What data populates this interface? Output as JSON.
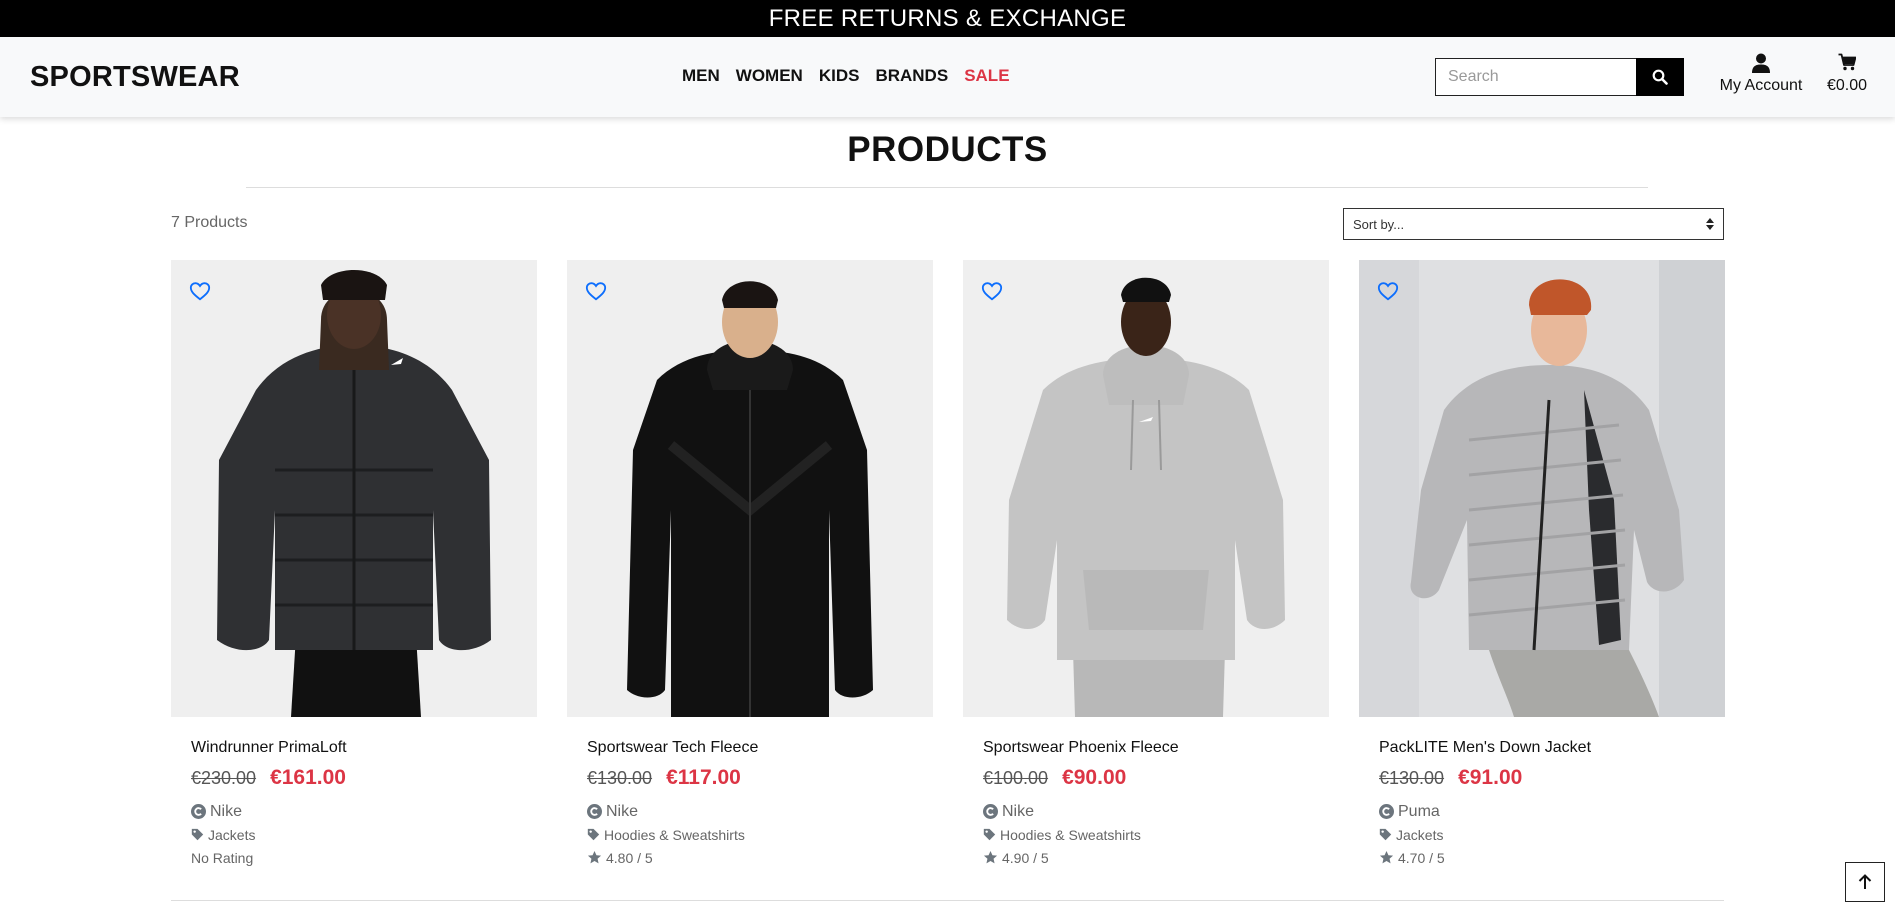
{
  "promo": {
    "text": "FREE RETURNS & EXCHANGE"
  },
  "header": {
    "brand": "SPORTSWEAR",
    "nav": [
      "MEN",
      "WOMEN",
      "KIDS",
      "BRANDS",
      "SALE"
    ],
    "search": {
      "placeholder": "Search",
      "value": ""
    },
    "account_label": "My Account",
    "cart_total": "€0.00"
  },
  "page": {
    "title": "PRODUCTS",
    "count": "7 Products",
    "sort_label": "Sort by..."
  },
  "products": [
    {
      "name": "Windrunner PrimaLoft",
      "old_price": "€230.00",
      "price": "€161.00",
      "brand": "Nike",
      "category": "Jackets",
      "rating": "No Rating"
    },
    {
      "name": "Sportswear Tech Fleece",
      "old_price": "€130.00",
      "price": "€117.00",
      "brand": "Nike",
      "category": "Hoodies & Sweatshirts",
      "rating": "4.80 / 5"
    },
    {
      "name": "Sportswear Phoenix Fleece",
      "old_price": "€100.00",
      "price": "€90.00",
      "brand": "Nike",
      "category": "Hoodies & Sweatshirts",
      "rating": "4.90 / 5"
    },
    {
      "name": "PackLITE Men's Down Jacket",
      "old_price": "€130.00",
      "price": "€91.00",
      "brand": "Puma",
      "category": "Jackets",
      "rating": "4.70 / 5"
    }
  ],
  "colors": {
    "sale": "#dc3545",
    "wishlist": "#0d6efd",
    "promo_bg": "#000000"
  },
  "icons": [
    "search-icon",
    "user-icon",
    "cart-icon",
    "heart-icon",
    "copyright-brand-icon",
    "tag-icon",
    "star-icon",
    "arrow-up-icon"
  ]
}
